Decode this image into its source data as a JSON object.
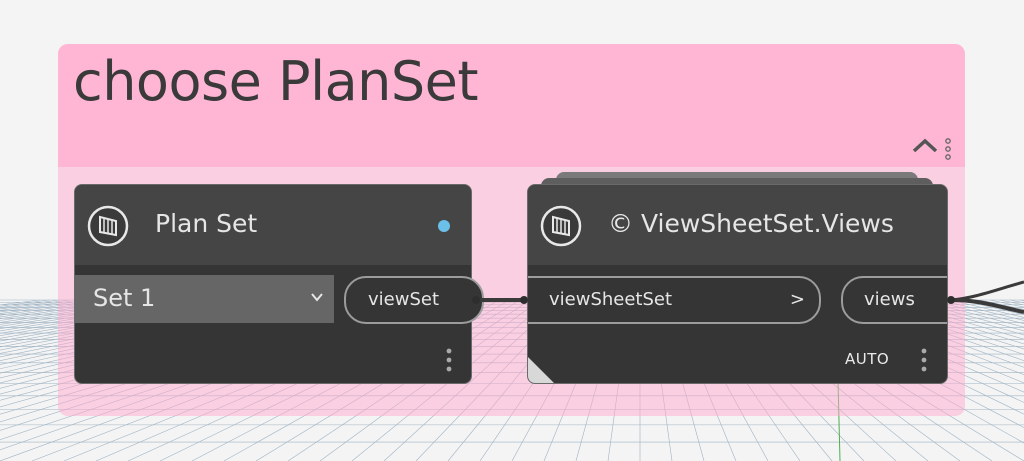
{
  "group": {
    "title": "choose PlanSet",
    "color": "#ffb6d5"
  },
  "nodes": {
    "plan_set": {
      "title": "Plan Set",
      "dropdown_value": "Set 1",
      "output_port": "viewSet"
    },
    "views": {
      "title": "© ViewSheetSet.Views",
      "input_port": "viewSheetSet",
      "input_arrow": ">",
      "output_port": "views",
      "lacing": "AUTO"
    }
  },
  "colors": {
    "node_body": "#353535",
    "node_header": "#454545",
    "accent": "#6ac0e8"
  }
}
